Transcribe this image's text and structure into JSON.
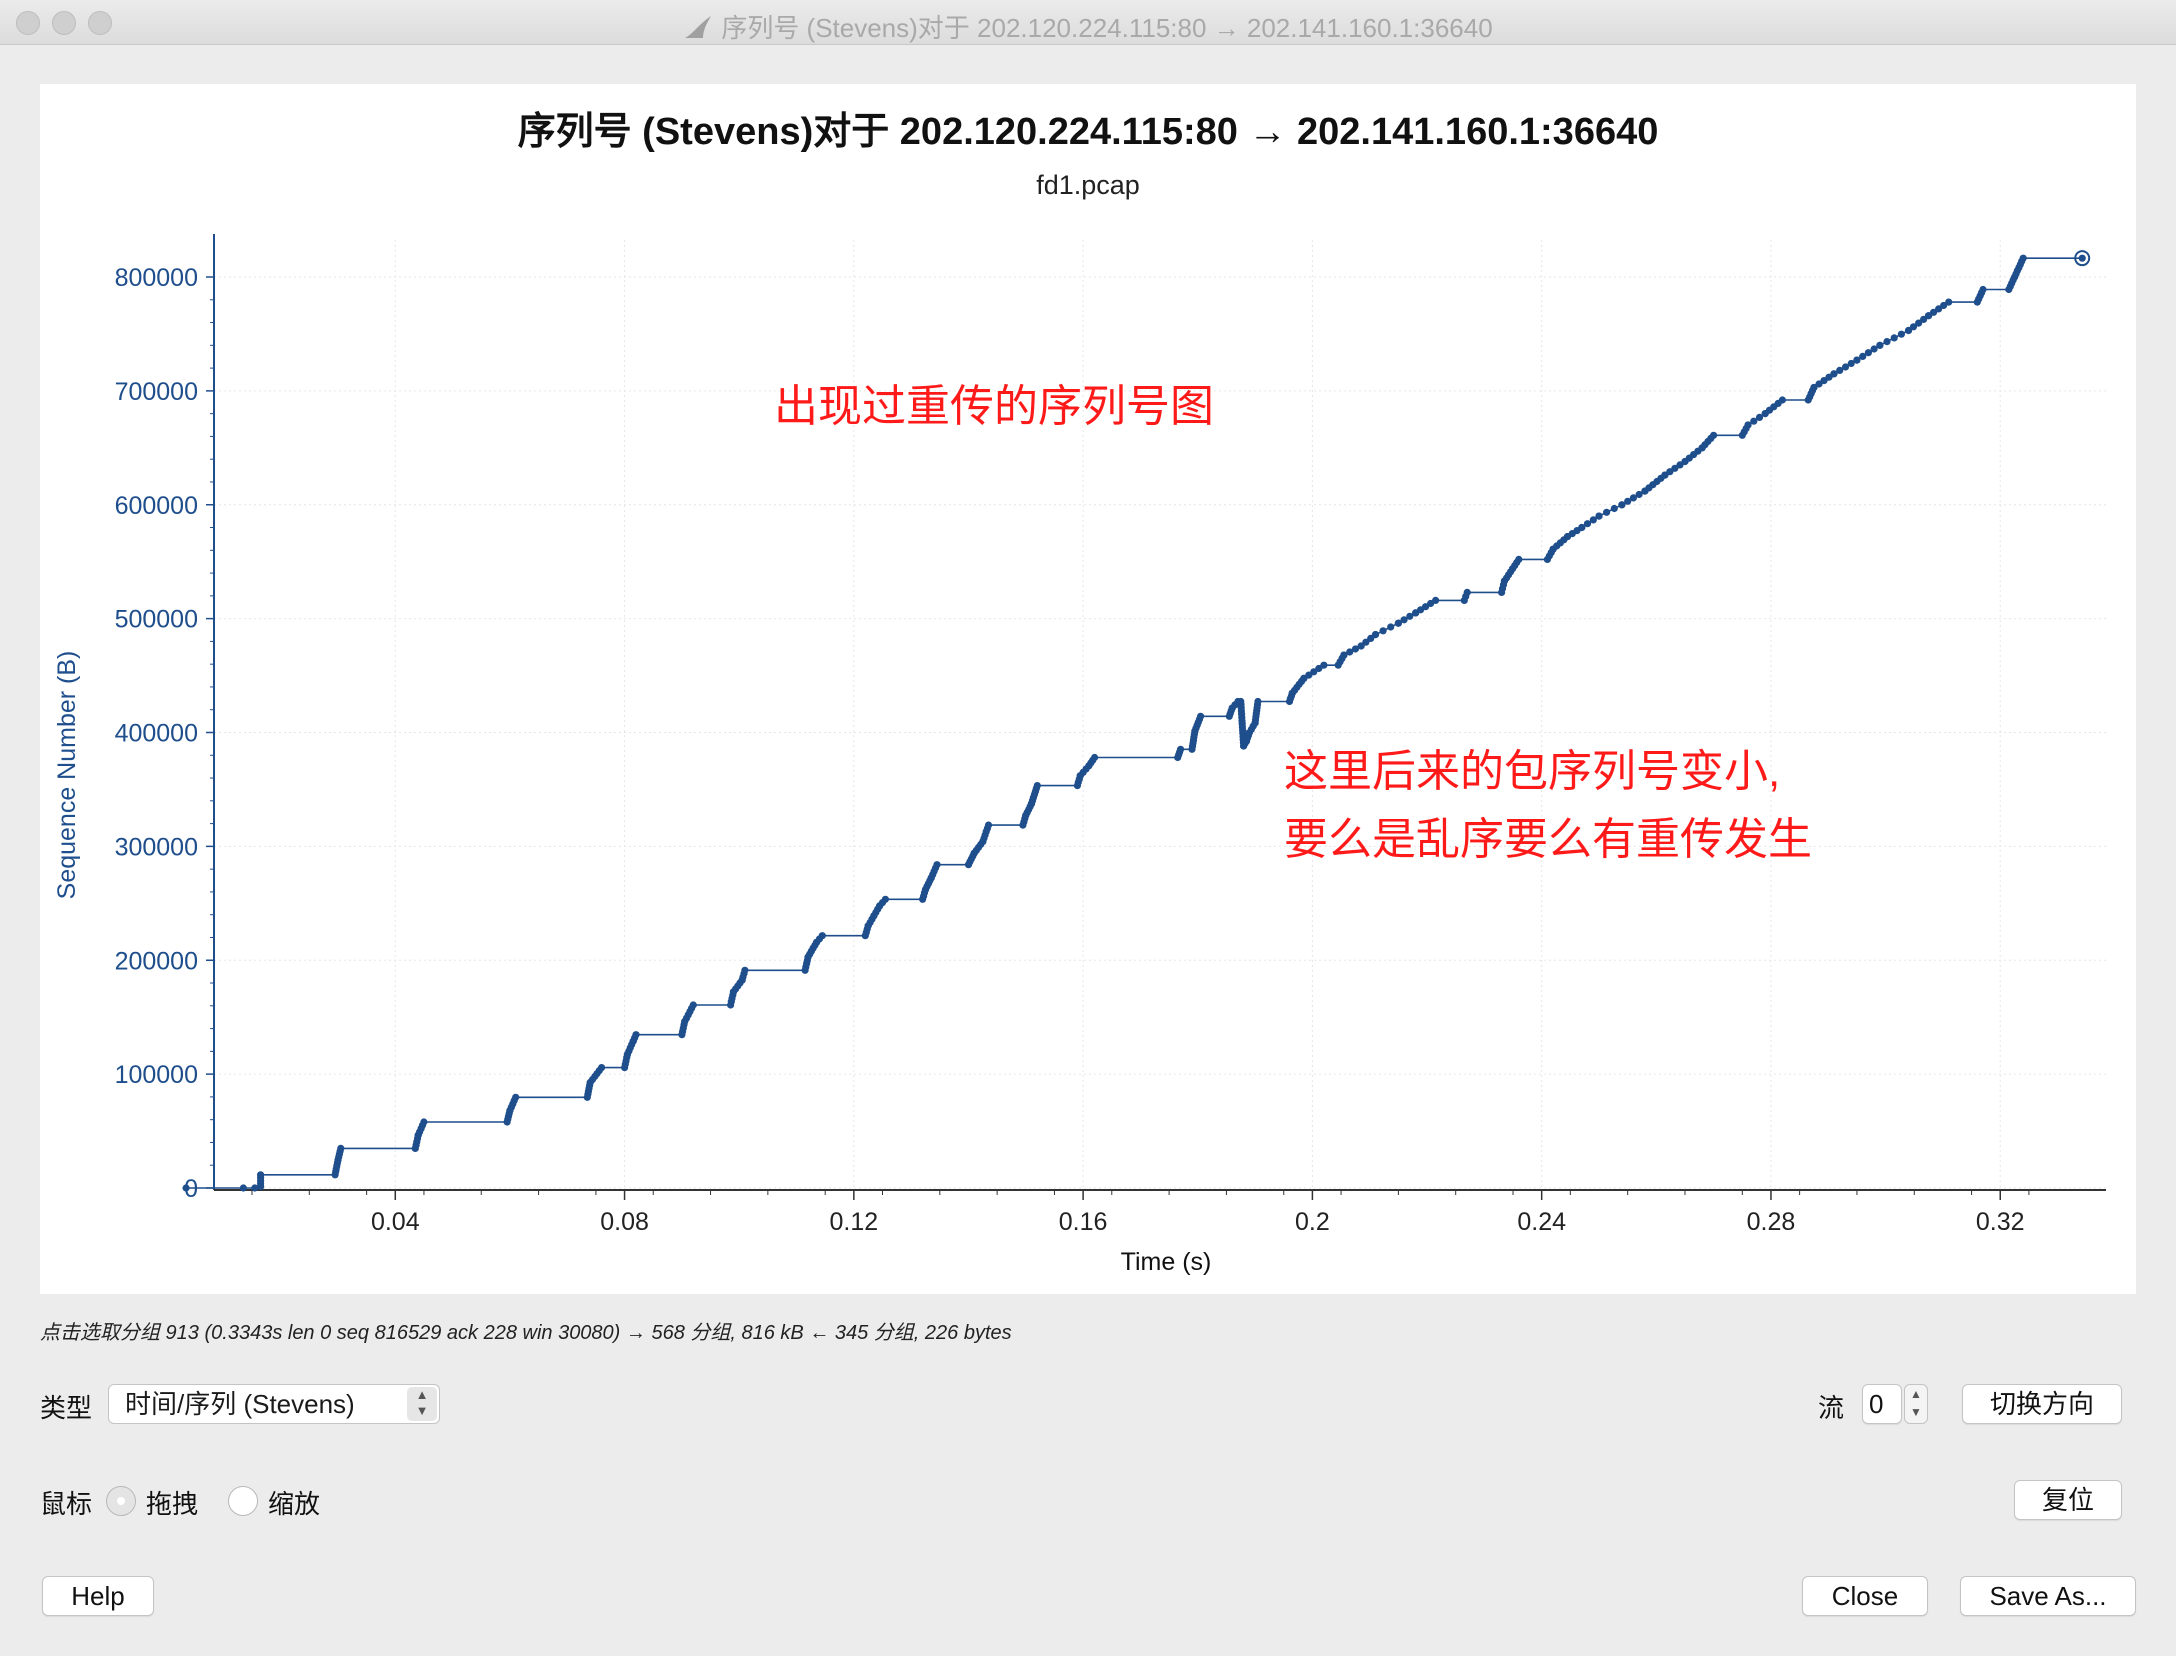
{
  "window": {
    "title": "序列号 (Stevens)对于 202.120.224.115:80 → 202.141.160.1:36640"
  },
  "chart_data": {
    "type": "scatter",
    "title": "序列号 (Stevens)对于 202.120.224.115:80 → 202.141.160.1:36640",
    "subtitle": "fd1.pcap",
    "xlabel": "Time (s)",
    "ylabel": "Sequence Number (B)",
    "xlim": [
      0.0,
      0.3343
    ],
    "ylim": [
      0,
      816529
    ],
    "x_ticks": [
      "0.04",
      "0.08",
      "0.12",
      "0.16",
      "0.2",
      "0.24",
      "0.28",
      "0.32"
    ],
    "x_tick_values": [
      0.04,
      0.08,
      0.12,
      0.16,
      0.2,
      0.24,
      0.28,
      0.32
    ],
    "y_ticks": [
      "0",
      "100000",
      "200000",
      "300000",
      "400000",
      "500000",
      "600000",
      "700000",
      "800000"
    ],
    "y_tick_values": [
      0,
      100000,
      200000,
      300000,
      400000,
      500000,
      600000,
      700000,
      800000
    ],
    "grid": true,
    "series_color": "#1f4e8c",
    "steps": [
      [
        0.0035,
        0
      ],
      [
        0.0135,
        0
      ],
      [
        0.0155,
        0
      ],
      [
        0.0165,
        1448
      ],
      [
        0.0165,
        11584
      ],
      [
        0.0295,
        11584
      ],
      [
        0.03,
        24616
      ],
      [
        0.0305,
        34752
      ],
      [
        0.0435,
        34752
      ],
      [
        0.044,
        46336
      ],
      [
        0.045,
        57920
      ],
      [
        0.0595,
        57920
      ],
      [
        0.06,
        68056
      ],
      [
        0.061,
        79640
      ],
      [
        0.0735,
        79640
      ],
      [
        0.074,
        92672
      ],
      [
        0.076,
        105704
      ],
      [
        0.08,
        105704
      ],
      [
        0.0805,
        117288
      ],
      [
        0.0815,
        128872
      ],
      [
        0.082,
        134664
      ],
      [
        0.09,
        134664
      ],
      [
        0.0905,
        146248
      ],
      [
        0.092,
        160728
      ],
      [
        0.0985,
        160728
      ],
      [
        0.099,
        172312
      ],
      [
        0.1005,
        182448
      ],
      [
        0.101,
        191136
      ],
      [
        0.1115,
        191136
      ],
      [
        0.112,
        202720
      ],
      [
        0.1135,
        215752
      ],
      [
        0.1145,
        221544
      ],
      [
        0.122,
        221544
      ],
      [
        0.1225,
        230232
      ],
      [
        0.1235,
        239000
      ],
      [
        0.1245,
        247688
      ],
      [
        0.1255,
        253480
      ],
      [
        0.132,
        253480
      ],
      [
        0.1325,
        262168
      ],
      [
        0.1335,
        272304
      ],
      [
        0.1345,
        283888
      ],
      [
        0.14,
        283888
      ],
      [
        0.141,
        294024
      ],
      [
        0.1425,
        304160
      ],
      [
        0.1435,
        318640
      ],
      [
        0.1495,
        318640
      ],
      [
        0.15,
        327328
      ],
      [
        0.151,
        337464
      ],
      [
        0.152,
        353392
      ],
      [
        0.159,
        353392
      ],
      [
        0.1595,
        362080
      ],
      [
        0.161,
        370768
      ],
      [
        0.162,
        378008
      ],
      [
        0.1765,
        378008
      ],
      [
        0.177,
        385248
      ],
      [
        0.179,
        385248
      ],
      [
        0.1795,
        401176
      ],
      [
        0.1805,
        414208
      ],
      [
        0.1855,
        414208
      ],
      [
        0.186,
        421448
      ],
      [
        0.187,
        427240
      ],
      [
        0.1875,
        427240
      ],
      [
        0.188,
        388144
      ],
      [
        0.1885,
        392488
      ],
      [
        0.189,
        399728
      ],
      [
        0.19,
        408416
      ],
      [
        0.1905,
        427240
      ],
      [
        0.196,
        427240
      ],
      [
        0.1965,
        434480
      ],
      [
        0.1985,
        447512
      ],
      [
        0.202,
        459096
      ],
      [
        0.2045,
        459096
      ],
      [
        0.2055,
        468000
      ],
      [
        0.2085,
        476000
      ],
      [
        0.211,
        486000
      ],
      [
        0.215,
        496000
      ],
      [
        0.218,
        505000
      ],
      [
        0.2215,
        516000
      ],
      [
        0.2265,
        516000
      ],
      [
        0.227,
        523000
      ],
      [
        0.233,
        523000
      ],
      [
        0.2335,
        533000
      ],
      [
        0.236,
        552000
      ],
      [
        0.241,
        552000
      ],
      [
        0.242,
        561000
      ],
      [
        0.2445,
        572000
      ],
      [
        0.247,
        580000
      ],
      [
        0.25,
        590000
      ],
      [
        0.254,
        600000
      ],
      [
        0.258,
        612000
      ],
      [
        0.2615,
        626000
      ],
      [
        0.265,
        638000
      ],
      [
        0.268,
        650000
      ],
      [
        0.27,
        661000
      ],
      [
        0.275,
        661000
      ],
      [
        0.276,
        670000
      ],
      [
        0.279,
        680000
      ],
      [
        0.282,
        692000
      ],
      [
        0.2865,
        692000
      ],
      [
        0.2875,
        703000
      ],
      [
        0.291,
        715000
      ],
      [
        0.295,
        727000
      ],
      [
        0.299,
        740000
      ],
      [
        0.304,
        753000
      ],
      [
        0.3075,
        766000
      ],
      [
        0.311,
        778000
      ],
      [
        0.316,
        778000
      ],
      [
        0.317,
        789000
      ],
      [
        0.3215,
        789000
      ],
      [
        0.3225,
        800000
      ],
      [
        0.324,
        816529
      ],
      [
        0.3343,
        816529
      ]
    ],
    "last_point": [
      0.3343,
      816529
    ]
  },
  "annotations": {
    "top": "出现过重传的序列号图",
    "right_line1": "这里后来的包序列号变小,",
    "right_line2": "要么是乱序要么有重传发生"
  },
  "status": "点击选取分组 913 (0.3343s len 0 seq 816529 ack 228 win 30080) → 568 分组, 816 kB ← 345 分组, 226 bytes",
  "controls": {
    "type_label": "类型",
    "type_value": "时间/序列 (Stevens)",
    "stream_label": "流",
    "stream_value": "0",
    "switch_direction": "切换方向",
    "mouse_label": "鼠标",
    "radio_drag": "拖拽",
    "radio_zoom": "缩放",
    "reset": "复位",
    "help": "Help",
    "close": "Close",
    "save_as": "Save As..."
  }
}
